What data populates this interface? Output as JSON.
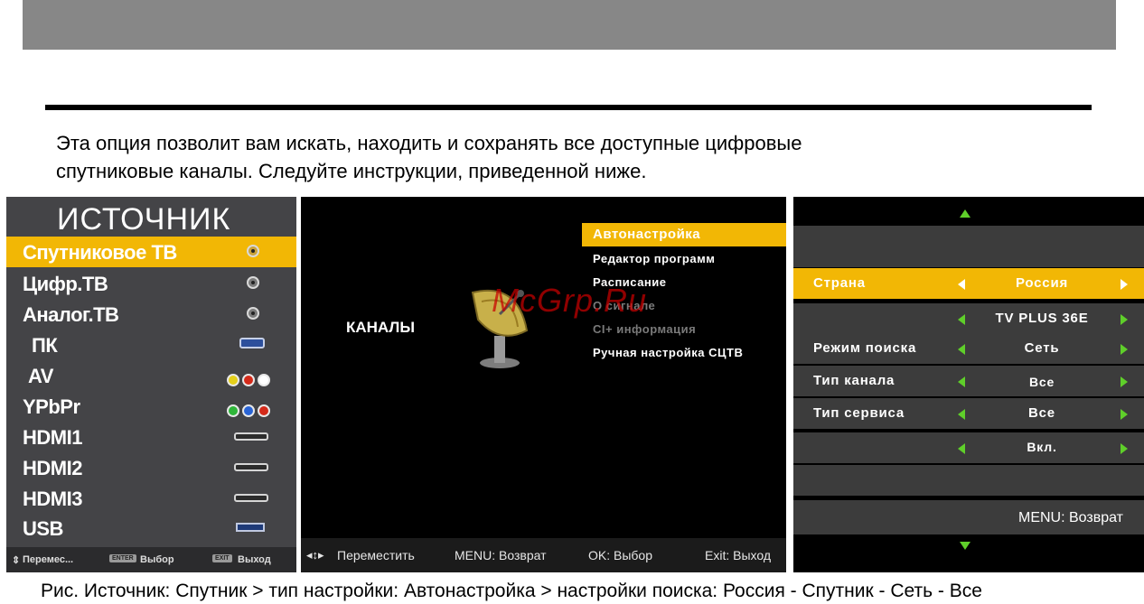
{
  "intro": {
    "line1": "Эта опция позволит вам искать, находить и сохранять все доступные цифровые",
    "line2": "спутниковые каналы. Следуйте инструкции, приведенной ниже."
  },
  "source_menu": {
    "title": "ИСТОЧНИК",
    "items": [
      {
        "label": "Спутниковое ТВ",
        "icon": "coax-connector-icon",
        "selected": true
      },
      {
        "label": "Цифр.ТВ",
        "icon": "coax-connector-icon"
      },
      {
        "label": "Аналог.ТВ",
        "icon": "coax-connector-icon"
      },
      {
        "label": "ПК",
        "icon": "vga-connector-icon"
      },
      {
        "label": "AV",
        "icon": "rca-av-connector-icon"
      },
      {
        "label": "YPbPr",
        "icon": "component-connector-icon"
      },
      {
        "label": "HDMI1",
        "icon": "hdmi-connector-icon"
      },
      {
        "label": "HDMI2",
        "icon": "hdmi-connector-icon"
      },
      {
        "label": "HDMI3",
        "icon": "hdmi-connector-icon"
      },
      {
        "label": "USB",
        "icon": "usb-connector-icon"
      }
    ],
    "footer": {
      "move": "Перемес...",
      "enter_key": "ENTER",
      "select": "Выбор",
      "exit_key": "EXIT",
      "exit": "Выход"
    }
  },
  "channels_menu": {
    "category": "КАНАЛЫ",
    "items": [
      {
        "label": "Автонастройка",
        "selected": true
      },
      {
        "label": "Редактор программ"
      },
      {
        "label": "Расписание"
      },
      {
        "label": "О сигнале",
        "disabled": true
      },
      {
        "label": "CI+ информация",
        "disabled": true
      },
      {
        "label": "Ручная настройка СЦТВ"
      }
    ],
    "footer": {
      "move": "Переместить",
      "back": "MENU: Возврат",
      "ok": "OK: Выбор",
      "exit": "Exit: Выход"
    }
  },
  "watermark": "McGrp.Ru",
  "auto_tuning": {
    "rows": [
      {
        "key": "Страна",
        "value": "Россия",
        "selected": true
      },
      {
        "key": "",
        "value": "TV PLUS 36E"
      },
      {
        "key": "Режим поиска",
        "value": "Сеть"
      },
      {
        "key": "Тип канала",
        "value": "Все"
      },
      {
        "key": "Тип сервиса",
        "value": "Все"
      },
      {
        "key": "",
        "value": "Вкл."
      }
    ],
    "footer": "MENU: Возврат"
  },
  "caption": "Рис. Источник: Спутник > тип настройки: Автонастройка > настройки поиска:  Россия - Спутник - Сеть - Все",
  "colors": {
    "highlight": "#f2b705",
    "arrow": "#5fcf2a",
    "panel_gray": "#444447"
  }
}
